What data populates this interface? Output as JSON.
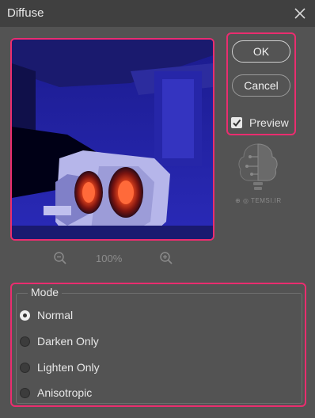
{
  "dialog": {
    "title": "Diffuse"
  },
  "buttons": {
    "ok_label": "OK",
    "cancel_label": "Cancel"
  },
  "preview": {
    "label": "Preview",
    "checked": true
  },
  "watermark": {
    "text": "TEMSI.IR"
  },
  "zoom": {
    "value": "100%"
  },
  "mode": {
    "legend": "Mode",
    "options": [
      {
        "label": "Normal",
        "selected": true
      },
      {
        "label": "Darken Only",
        "selected": false
      },
      {
        "label": "Lighten Only",
        "selected": false
      },
      {
        "label": "Anisotropic",
        "selected": false
      }
    ]
  },
  "colors": {
    "highlight": "#ea2d6f",
    "panel": "#535353",
    "titlebar": "#404040"
  }
}
